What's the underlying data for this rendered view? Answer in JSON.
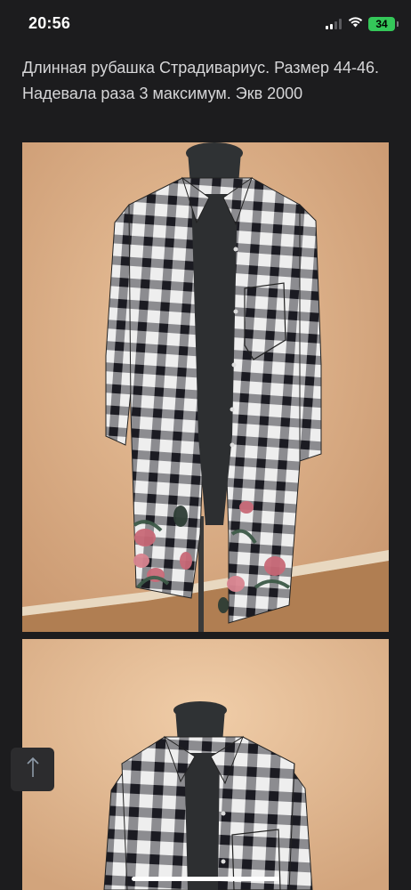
{
  "status_bar": {
    "time": "20:56",
    "battery_level": "34",
    "battery_color": "#34c759",
    "icons": [
      "signal-icon",
      "wifi-icon",
      "battery-icon"
    ]
  },
  "listing": {
    "description": "Длинная рубашка Страдивариус. Размер 44-46. Надевала раза 3 максимум. Экв 2000"
  },
  "photos": [
    {
      "subject": "plaid-shirt-on-mannequin"
    },
    {
      "subject": "plaid-shirt-on-mannequin"
    }
  ],
  "controls": {
    "scroll_top_icon": "arrow-up-icon"
  },
  "colors": {
    "background": "#1c1c1e",
    "text": "#d6d6d8",
    "button": "#2c2c2e"
  }
}
